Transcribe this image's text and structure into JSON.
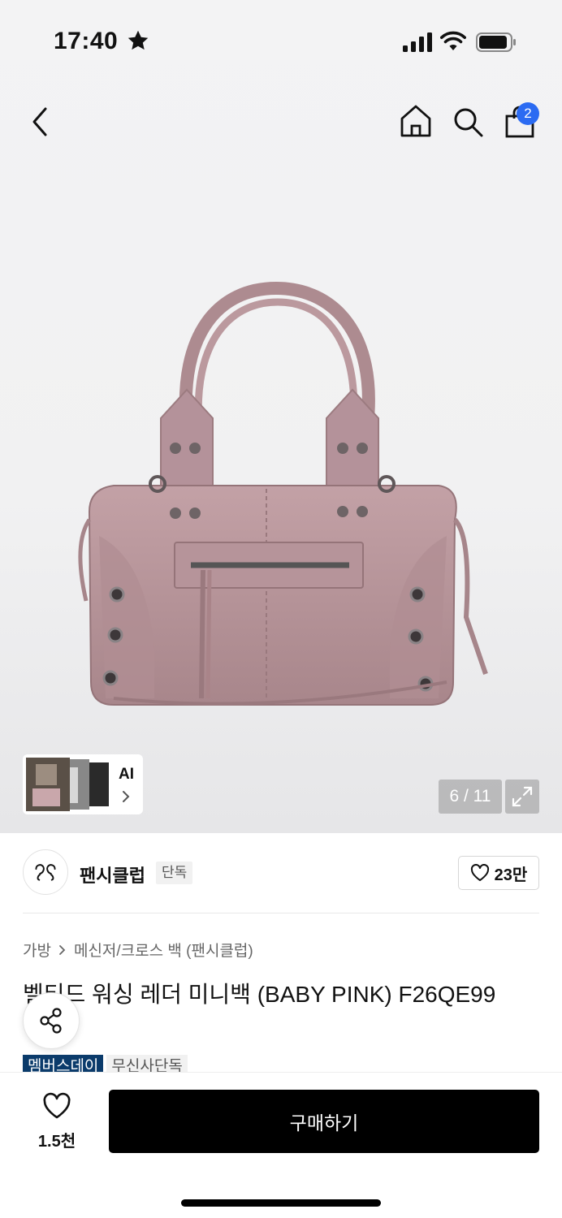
{
  "status_bar": {
    "time": "17:40",
    "icons": [
      "star-icon",
      "signal-icon",
      "wifi-icon",
      "battery-icon"
    ]
  },
  "top_nav": {
    "icons": [
      "back-icon",
      "home-icon",
      "search-icon",
      "shopping-bag-icon"
    ],
    "cart_count": "2",
    "badge_color": "#2b6bf2"
  },
  "gallery": {
    "ai_label": "AI",
    "counter": "6 / 11",
    "product_color": "#b99599"
  },
  "brand": {
    "name": "팬시클럽",
    "tag": "단독",
    "likes": "23만"
  },
  "breadcrumb": [
    "가방",
    "메신저/크로스 백 (팬시클럽)"
  ],
  "product": {
    "title": "벨티드 워싱 레더 미니백 (BABY PINK) F26QE99"
  },
  "badges": {
    "members_day": "멤버스데이",
    "exclusive": "무신사단독",
    "members_color": "#0b3b6b"
  },
  "bottom_bar": {
    "wish_count": "1.5천",
    "buy_label": "구매하기"
  }
}
